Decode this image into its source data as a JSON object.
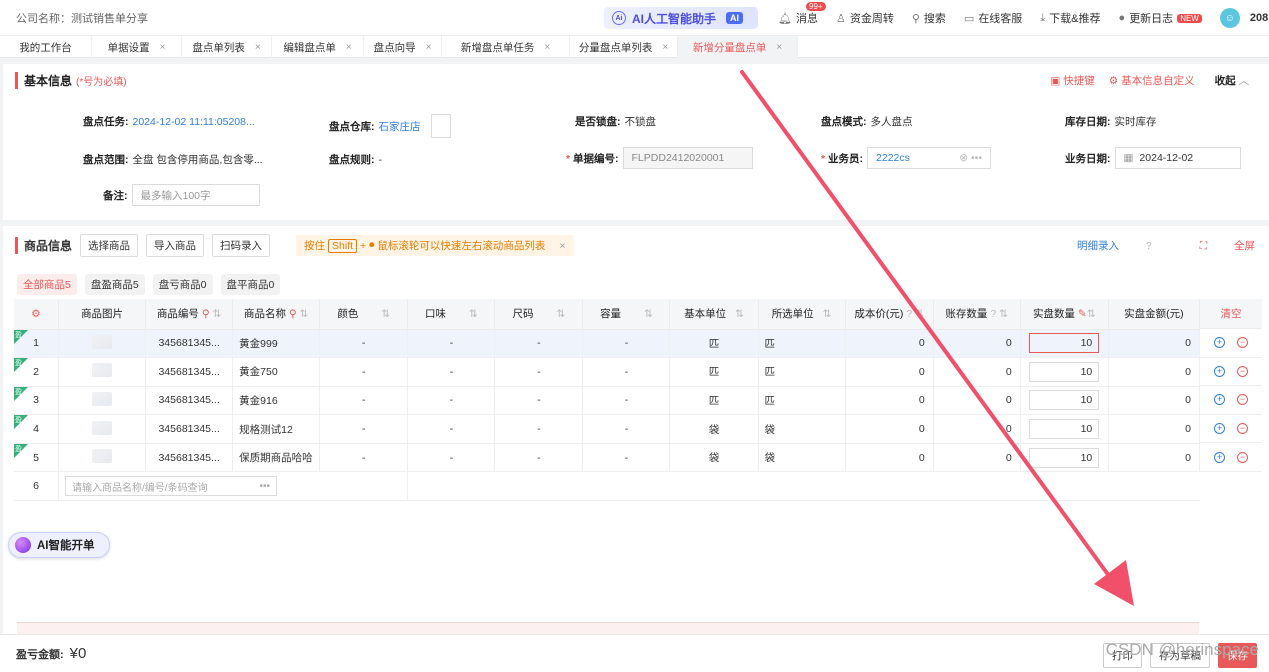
{
  "topbar": {
    "company": "公司名称：测试销售单分享",
    "ai_assistant": "AI人工智能助手",
    "ai_badge": "AI",
    "messages": "消息",
    "messages_count": "99+",
    "funds": "资金周转",
    "search": "搜索",
    "service": "在线客服",
    "download": "下载&推荐",
    "changelog": "更新日志",
    "new_tag": "NEW",
    "user_id": "208"
  },
  "tabs": [
    {
      "label": "我的工作台",
      "close": ""
    },
    {
      "label": "单据设置",
      "close": "×"
    },
    {
      "label": "盘点单列表",
      "close": "×"
    },
    {
      "label": "编辑盘点单",
      "close": "×"
    },
    {
      "label": "盘点向导",
      "close": "×"
    },
    {
      "label": "新增盘点单任务",
      "close": "×"
    },
    {
      "label": "分量盘点单列表",
      "close": "×"
    },
    {
      "label": "新增分量盘点单",
      "close": "×"
    }
  ],
  "basic": {
    "title": "基本信息",
    "required_note": "(*号为必填)",
    "shortcut": "快捷键",
    "customize": "基本信息自定义",
    "collapse": "收起",
    "task_label": "盘点任务:",
    "task_value": "2024-12-02 11:11:05208...",
    "warehouse_label": "盘点仓库:",
    "warehouse_value": "石家庄店",
    "lock_label": "是否锁盘:",
    "lock_value": "不锁盘",
    "mode_label": "盘点模式:",
    "mode_value": "多人盘点",
    "stockdate_label": "库存日期:",
    "stockdate_value": "实时库存",
    "range_label": "盘点范围:",
    "range_value": "全盘 包含停用商品,包含零...",
    "rule_label": "盘点规则:",
    "rule_value": "-",
    "docno_label": "单据编号:",
    "docno_value": "FLPDD2412020001",
    "staff_label": "业务员:",
    "staff_value": "2222cs",
    "bizdate_label": "业务日期:",
    "bizdate_value": "2024-12-02",
    "remark_label": "备注:",
    "remark_placeholder": "最多输入100字"
  },
  "goods": {
    "title": "商品信息",
    "btn_select": "选择商品",
    "btn_import": "导入商品",
    "btn_scan": "扫码录入",
    "hint_a": "按住",
    "hint_key": "Shift",
    "hint_b": "+",
    "hint_c": "鼠标滚轮可以快速左右滚动商品列表",
    "detail_entry": "明细录入",
    "fullscreen": "全屏",
    "filters": [
      "全部商品5",
      "盘盈商品5",
      "盘亏商品0",
      "盘平商品0"
    ],
    "columns": [
      "",
      "商品图片",
      "商品编号",
      "商品名称",
      "颜色",
      "口味",
      "尺码",
      "容量",
      "基本单位",
      "所选单位",
      "成本价(元)",
      "账存数量",
      "实盘数量",
      "实盘金额(元)"
    ],
    "rows": [
      {
        "no": "1",
        "tag": "盈",
        "code": "345681345...",
        "name": "黄金999",
        "color": "-",
        "taste": "-",
        "size": "-",
        "cap": "-",
        "unit": "匹",
        "sel": "匹",
        "cost": "0",
        "book": "0",
        "qty": "10",
        "amt": "0"
      },
      {
        "no": "2",
        "tag": "盈",
        "code": "345681345...",
        "name": "黄金750",
        "color": "-",
        "taste": "-",
        "size": "-",
        "cap": "-",
        "unit": "匹",
        "sel": "匹",
        "cost": "0",
        "book": "0",
        "qty": "10",
        "amt": "0"
      },
      {
        "no": "3",
        "tag": "盈",
        "code": "345681345...",
        "name": "黄金916",
        "color": "-",
        "taste": "-",
        "size": "-",
        "cap": "-",
        "unit": "匹",
        "sel": "匹",
        "cost": "0",
        "book": "0",
        "qty": "10",
        "amt": "0"
      },
      {
        "no": "4",
        "tag": "盈",
        "code": "345681345...",
        "name": "规格测试12",
        "color": "-",
        "taste": "-",
        "size": "-",
        "cap": "-",
        "unit": "袋",
        "sel": "袋",
        "cost": "0",
        "book": "0",
        "qty": "10",
        "amt": "0"
      },
      {
        "no": "5",
        "tag": "盈",
        "code": "345681345...",
        "name": "保质期商品哈哈",
        "color": "-",
        "taste": "-",
        "size": "-",
        "cap": "-",
        "unit": "袋",
        "sel": "袋",
        "cost": "0",
        "book": "0",
        "qty": "10",
        "amt": "0"
      }
    ],
    "new_row_no": "6",
    "new_row_placeholder": "请输入商品名称/编号/条码查询",
    "new_row_more": "•••",
    "clear": "清空"
  },
  "ai_open": "AI智能开单",
  "footer": {
    "label": "盈亏金额:",
    "amount": "¥0",
    "print": "打印",
    "save_draft": "存为草稿",
    "save": "保存"
  },
  "watermark": "CSDN @herinspace"
}
